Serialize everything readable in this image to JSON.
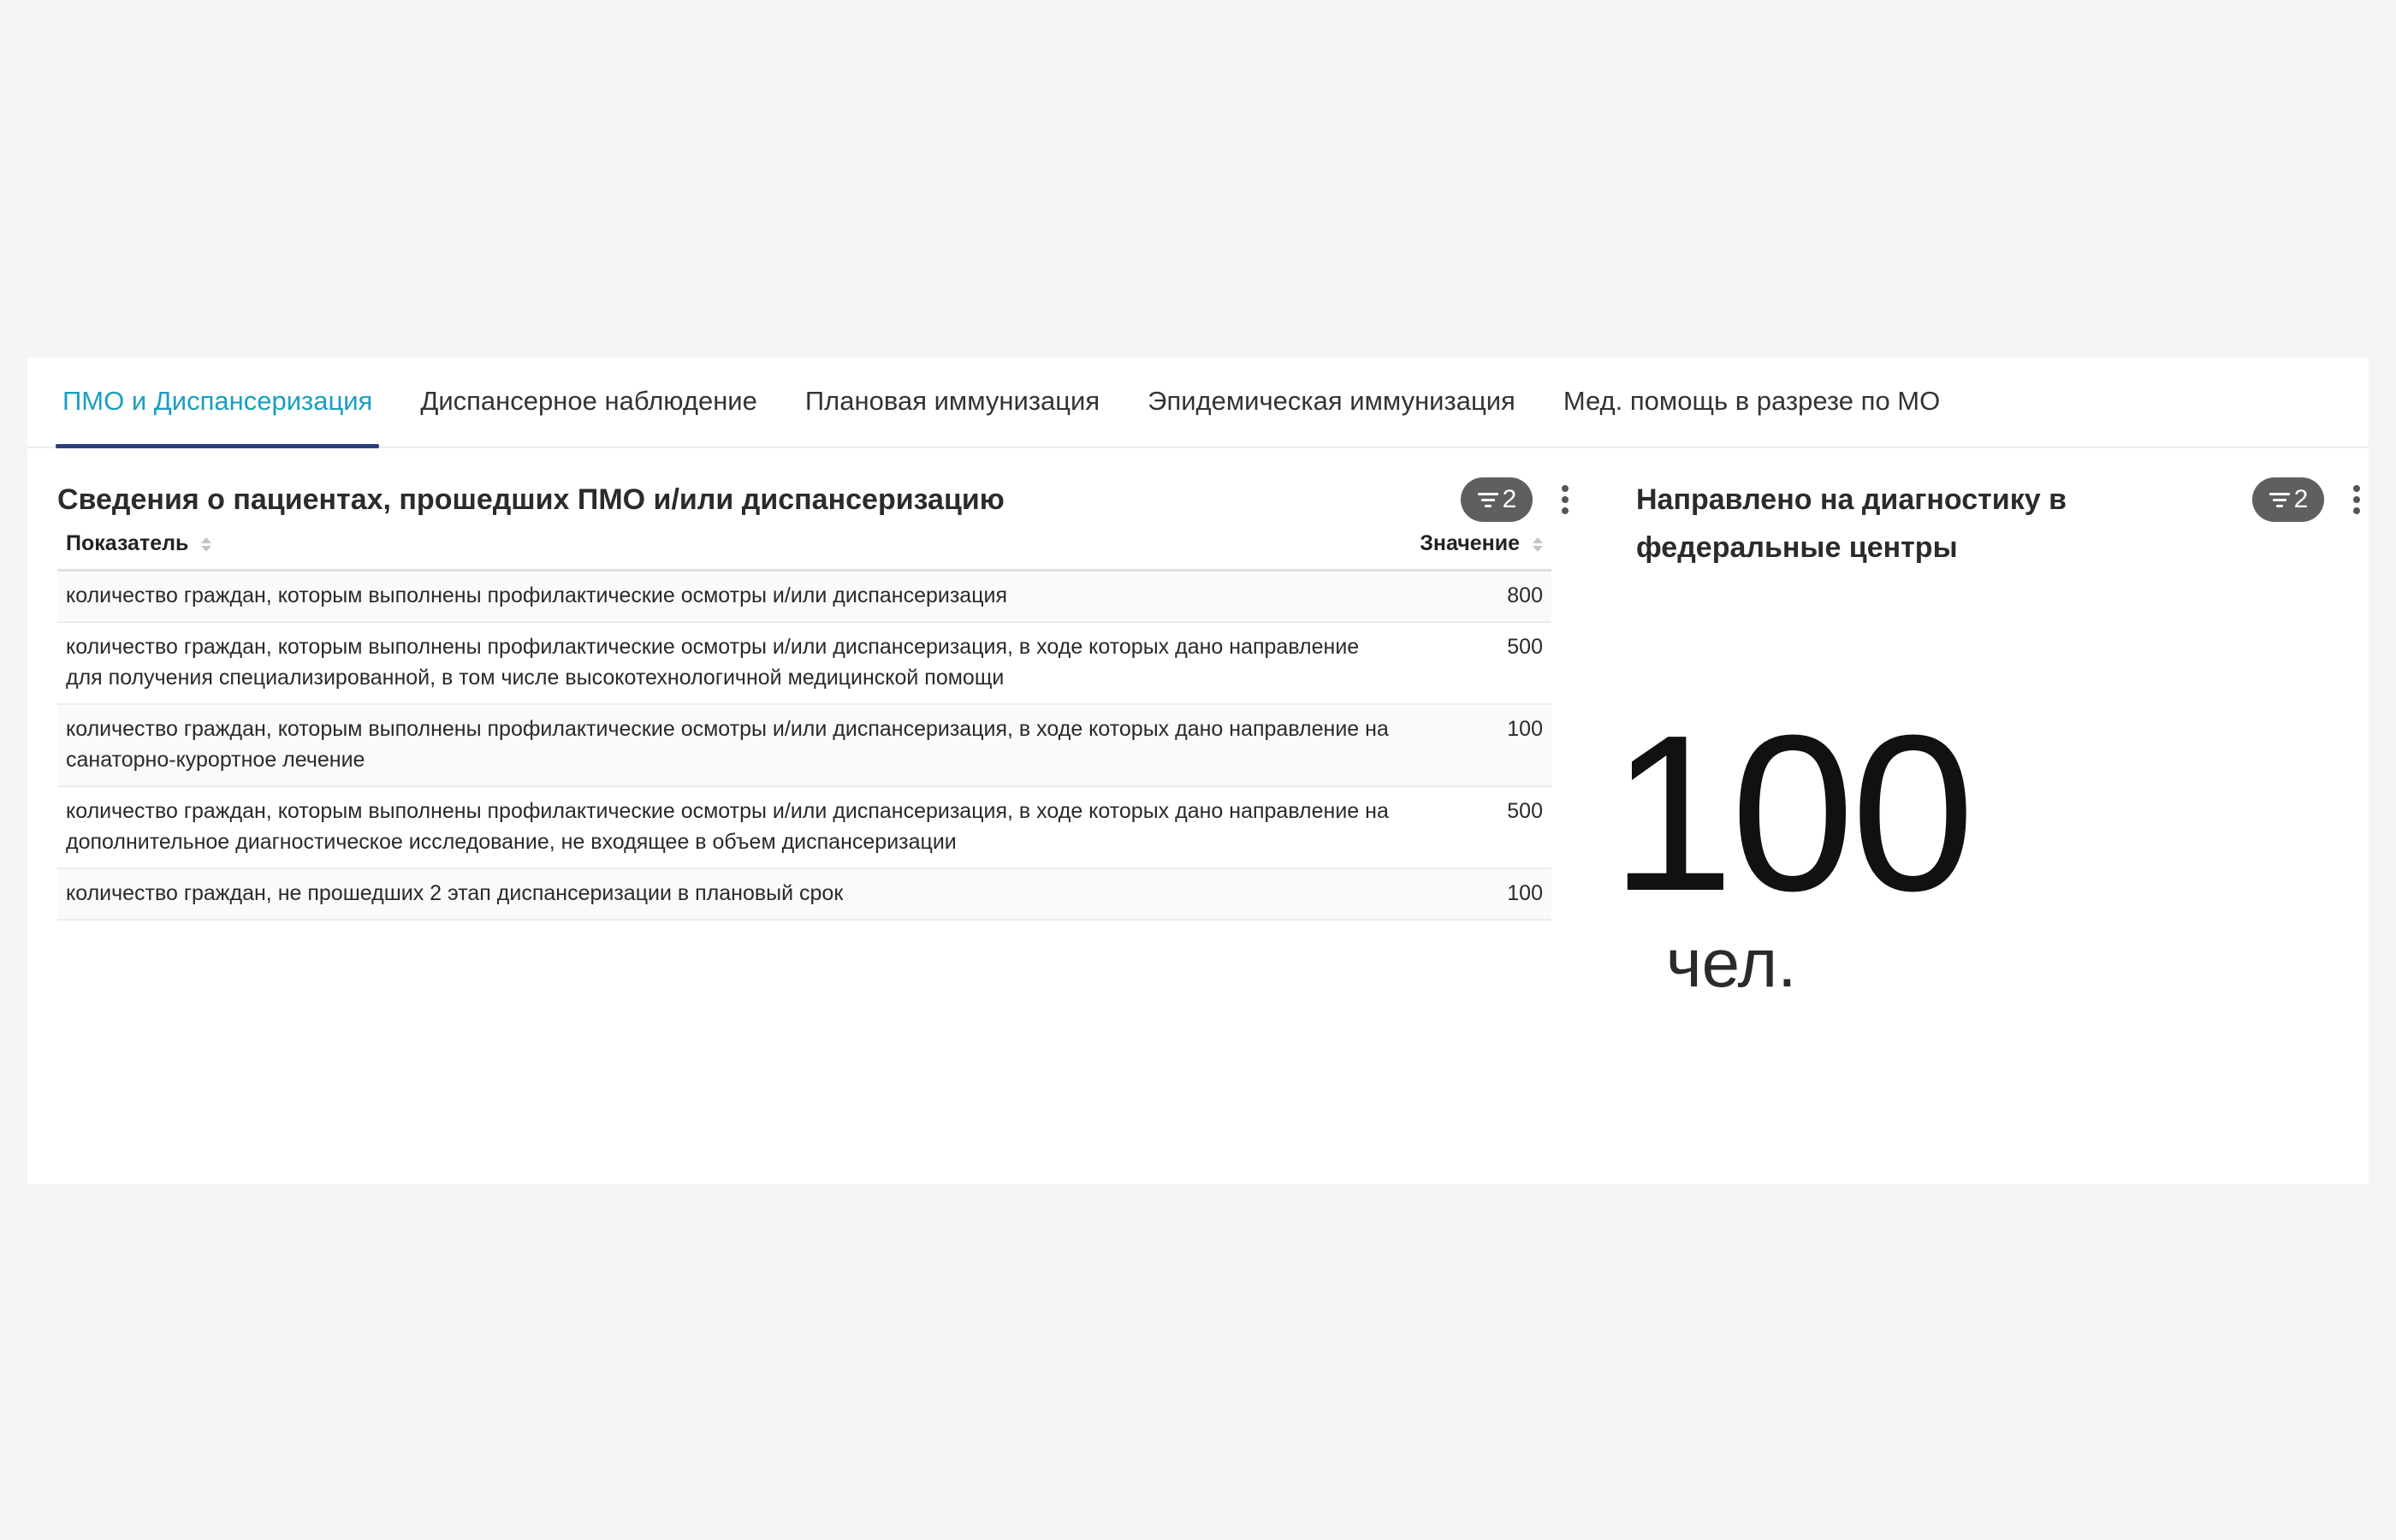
{
  "tabs": [
    {
      "label": "ПМО и Диспансеризация",
      "active": true
    },
    {
      "label": "Диспансерное наблюдение",
      "active": false
    },
    {
      "label": "Плановая иммунизация",
      "active": false
    },
    {
      "label": "Эпидемическая иммунизация",
      "active": false
    },
    {
      "label": "Мед. помощь в разрезе по МО",
      "active": false
    }
  ],
  "table_panel": {
    "title": "Сведения о пациентах, прошедших ПМО и/или диспансеризацию",
    "filter_count": "2",
    "columns": {
      "indicator": "Показатель",
      "value": "Значение"
    },
    "rows": [
      {
        "indicator": "количество граждан, которым выполнены профилактические осмотры и/или диспансеризация",
        "value": "800"
      },
      {
        "indicator": "количество граждан, которым выполнены профилактические осмотры и/или диспансеризация, в ходе которых дано направление для получения специализированной, в том числе высокотехнологичной медицинской помощи",
        "value": "500"
      },
      {
        "indicator": "количество граждан, которым выполнены профилактические осмотры и/или диспансеризация, в ходе которых дано направление на санаторно-курортное лечение",
        "value": "100"
      },
      {
        "indicator": "количество граждан, которым выполнены профилактические осмотры и/или диспансеризация, в ходе которых дано направление на дополнительное диагностическое исследование, не входящее в объем диспансеризации",
        "value": "500"
      },
      {
        "indicator": "количество граждан, не прошедших 2 этап диспансеризации в плановый срок",
        "value": "100"
      }
    ]
  },
  "kpi_panel": {
    "title": "Направлено на диагностику в федеральные центры",
    "filter_count": "2",
    "value": "100",
    "unit": "чел."
  },
  "colors": {
    "active_tab_text": "#1a9ec0",
    "active_tab_underline": "#2c3e7a",
    "filter_badge": "#5f5f5f"
  },
  "icons": [
    "filter-icon",
    "more-vertical-icon",
    "sort-icon"
  ]
}
